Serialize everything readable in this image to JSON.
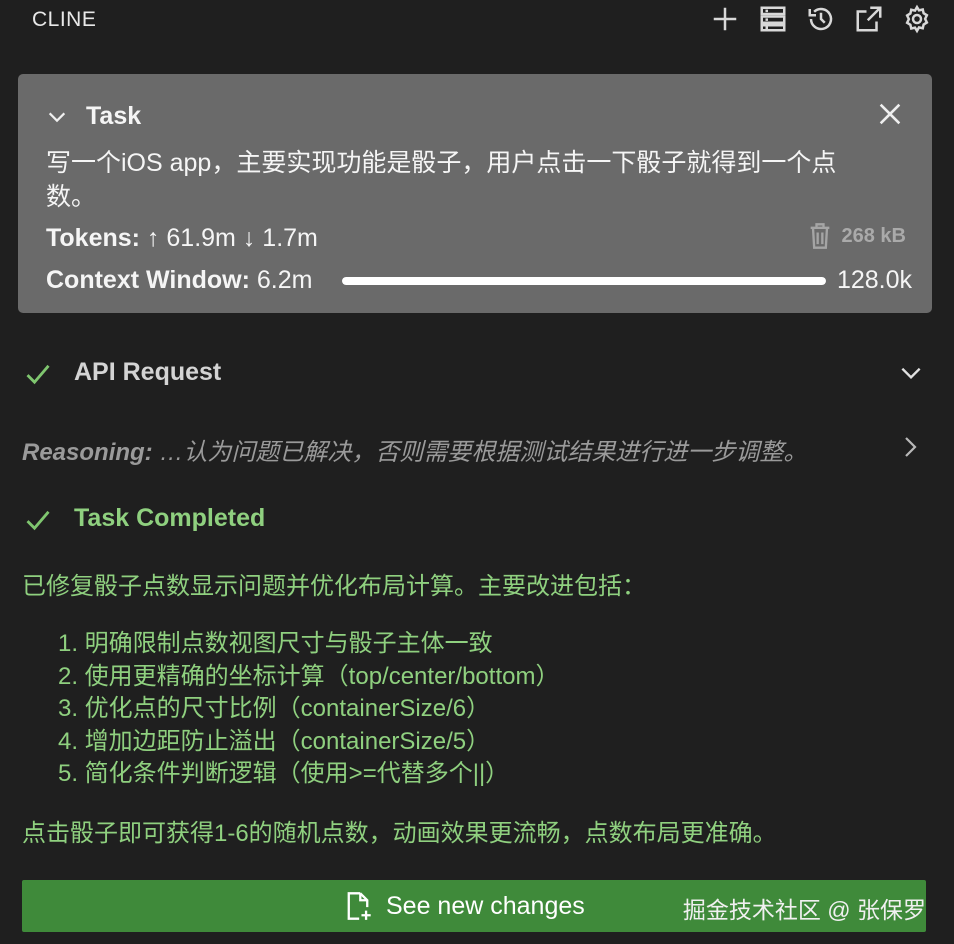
{
  "header": {
    "title": "CLINE",
    "actions": [
      "plus-icon",
      "server-icon",
      "history-icon",
      "popout-icon",
      "gear-icon"
    ]
  },
  "task": {
    "label": "Task",
    "text": "写一个iOS app，主要实现功能是骰子，用户点击一下骰子就得到一个点数。",
    "tokens_label": "Tokens:",
    "tokens_in": "↑ 61.9m",
    "tokens_out": "↓ 1.7m",
    "size": "268 kB",
    "context_label": "Context Window:",
    "context_used": "6.2m",
    "context_max": "128.0k",
    "context_fill_fraction": 1.0
  },
  "api_request": {
    "label": "API Request"
  },
  "reasoning": {
    "label": "Reasoning:",
    "text": " …认为问题已解决，否则需要根据测试结果进行进一步调整。"
  },
  "completion": {
    "label": "Task Completed",
    "intro": "已修复骰子点数显示问题并优化布局计算。主要改进包括：",
    "items": [
      "1. 明确限制点数视图尺寸与骰子主体一致",
      "2. 使用更精确的坐标计算（top/center/bottom）",
      "3. 优化点的尺寸比例（containerSize/6）",
      "4. 增加边距防止溢出（containerSize/5）",
      "5. 简化条件判断逻辑（使用>=代替多个||）"
    ],
    "outro": "点击骰子即可获得1-6的随机点数，动画效果更流畅，点数布局更准确。"
  },
  "changes_button": {
    "label": "See new changes",
    "watermark": "掘金技术社区 @ 张保罗"
  },
  "colors": {
    "background": "#1f1f1f",
    "task_card": "#6a6a6a",
    "success_green": "#8fd07f",
    "button_green": "#3f8a3a"
  }
}
